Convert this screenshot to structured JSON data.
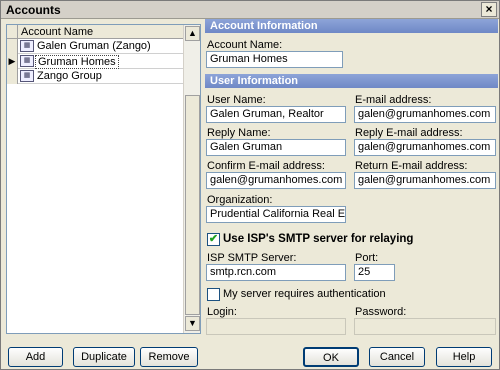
{
  "window": {
    "title": "Accounts",
    "close_glyph": "×"
  },
  "list": {
    "column_header": "Account Name",
    "rows": [
      {
        "name": "Galen Gruman (Zango)",
        "selected": false,
        "marker": ""
      },
      {
        "name": "Gruman Homes",
        "selected": true,
        "marker": "▶"
      },
      {
        "name": "Zango Group",
        "selected": false,
        "marker": ""
      }
    ],
    "scroll_up_glyph": "▲",
    "scroll_down_glyph": "▼"
  },
  "account_info": {
    "header": "Account Information",
    "account_name_label": "Account Name:",
    "account_name_value": "Gruman Homes"
  },
  "user_info": {
    "header": "User Information",
    "user_name_label": "User Name:",
    "user_name_value": "Galen Gruman, Realtor",
    "email_label": "E-mail address:",
    "email_value": "galen@grumanhomes.com",
    "reply_name_label": "Reply Name:",
    "reply_name_value": "Galen Gruman",
    "reply_email_label": "Reply E-mail address:",
    "reply_email_value": "galen@grumanhomes.com",
    "confirm_email_label": "Confirm E-mail address:",
    "confirm_email_value": "galen@grumanhomes.com",
    "return_email_label": "Return E-mail address:",
    "return_email_value": "galen@grumanhomes.com",
    "organization_label": "Organization:",
    "organization_value": "Prudential California Real Estate"
  },
  "smtp": {
    "use_isp_label": "Use ISP's SMTP server for relaying",
    "use_isp_checked": true,
    "check_glyph": "✔",
    "server_label": "ISP SMTP Server:",
    "server_value": "smtp.rcn.com",
    "port_label": "Port:",
    "port_value": "25",
    "auth_label": "My server requires authentication",
    "auth_checked": false,
    "login_label": "Login:",
    "login_value": "",
    "password_label": "Password:",
    "password_value": ""
  },
  "buttons": {
    "add": "Add",
    "duplicate": "Duplicate",
    "remove": "Remove",
    "ok": "OK",
    "cancel": "Cancel",
    "help": "Help"
  }
}
